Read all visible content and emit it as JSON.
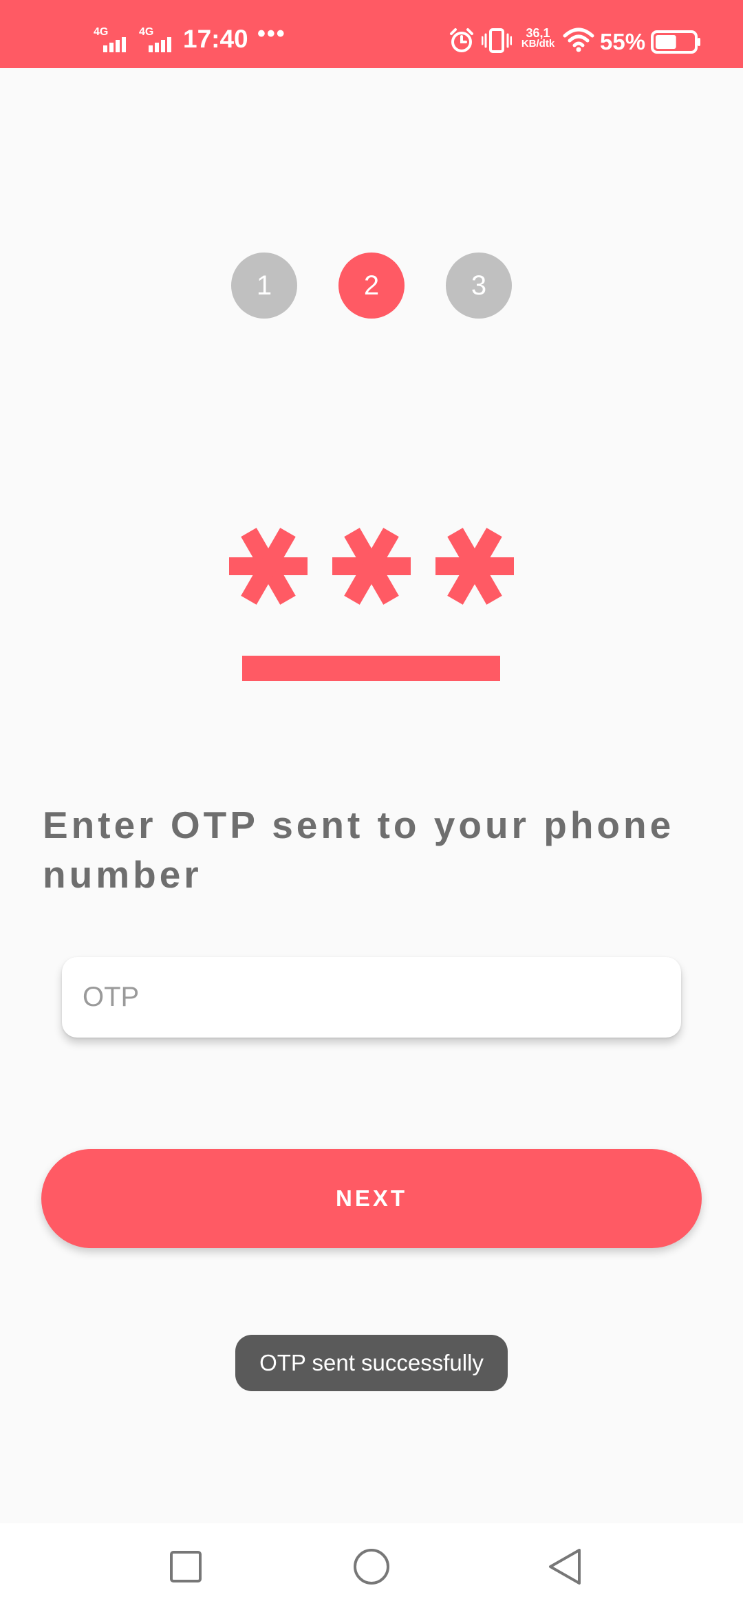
{
  "status_bar": {
    "network_1": "4G",
    "network_2": "4G",
    "time": "17:40",
    "more": "•••",
    "speed_value": "36,1",
    "speed_unit": "KB/dtk",
    "battery_percent": "55%",
    "battery_level": 0.55
  },
  "stepper": {
    "steps": [
      "1",
      "2",
      "3"
    ],
    "active_step": 2
  },
  "heading": "Enter OTP sent to your phone number",
  "otp": {
    "placeholder": "OTP",
    "value": ""
  },
  "next_button_label": "NEXT",
  "toast": "OTP sent successfully",
  "colors": {
    "accent": "#ff5a64",
    "step_inactive": "#c0c0c0",
    "heading_text": "#6e6e6e",
    "toast_bg": "#5a5a5a",
    "background": "#fafafa"
  },
  "icons": {
    "hero": "password-asterisks-icon",
    "alarm": "alarm-icon",
    "vibrate": "vibrate-icon",
    "wifi": "wifi-icon",
    "battery": "battery-icon",
    "nav_recents": "square-recents-icon",
    "nav_home": "circle-home-icon",
    "nav_back": "triangle-back-icon"
  }
}
